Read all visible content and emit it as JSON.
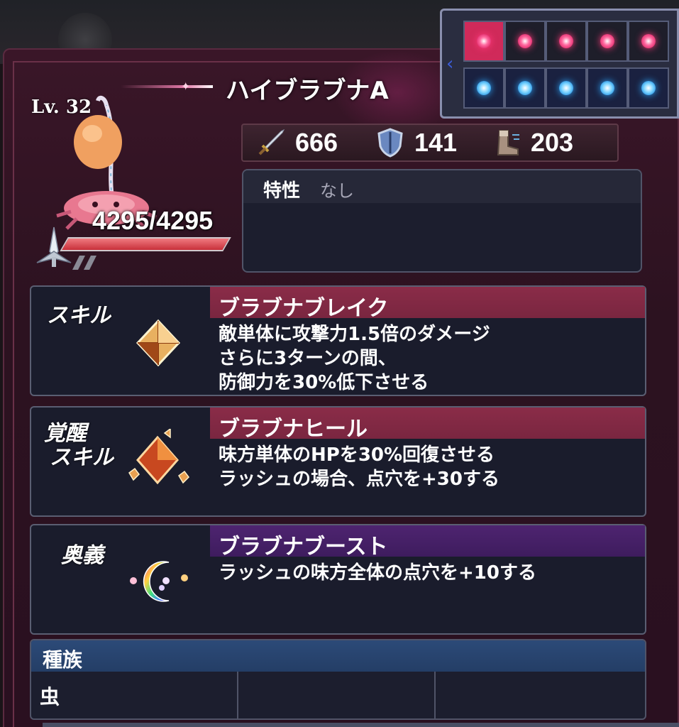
{
  "monster": {
    "name": "ハイブラブナA",
    "level": "Lv. 32",
    "hp": "4295/4295",
    "hp_fraction": 1.0
  },
  "dot_grid": {
    "top_row": [
      "red",
      "red",
      "red",
      "red",
      "red"
    ],
    "bottom_row": [
      "blue",
      "blue",
      "blue",
      "blue",
      "blue"
    ],
    "active_top_index": 0
  },
  "stats": {
    "attack": {
      "icon": "sword-icon",
      "value": "666"
    },
    "defense": {
      "icon": "shield-icon",
      "value": "141"
    },
    "speed": {
      "icon": "boot-icon",
      "value": "203"
    }
  },
  "trait": {
    "label": "特性",
    "value": "なし"
  },
  "skills": [
    {
      "label": "スキル",
      "name": "ブラブナブレイク",
      "desc": [
        "敵単体に攻撃力1.5倍のダメージ",
        "さらに3ターンの間、",
        "防御力を30%低下させる"
      ],
      "icon": "amber-crystal-icon",
      "head_color": "#8a2c48"
    },
    {
      "label": "覚醒\nスキル",
      "label_lines": [
        "覚醒",
        "スキル"
      ],
      "name": "ブラブナヒール",
      "desc": [
        "味方単体のHPを30%回復させる",
        "ラッシュの場合、点穴を+30する"
      ],
      "icon": "crystal-cluster-icon",
      "head_color": "#8a2c48"
    },
    {
      "label": "奥義",
      "name": "ブラブナブースト",
      "desc": [
        "ラッシュの味方全体の点穴を+10する"
      ],
      "icon": "rainbow-crescent-icon",
      "head_color": "#4e2470"
    }
  ],
  "tribe": {
    "label": "種族",
    "values": [
      "虫",
      "",
      ""
    ]
  },
  "colors": {
    "panel_bg": "#2c1220",
    "skill_header_red": "#8a2c48",
    "ultimate_header_purple": "#4e2470",
    "tribe_header_blue": "#2c4a78",
    "hp_fill": "#c8303a"
  }
}
